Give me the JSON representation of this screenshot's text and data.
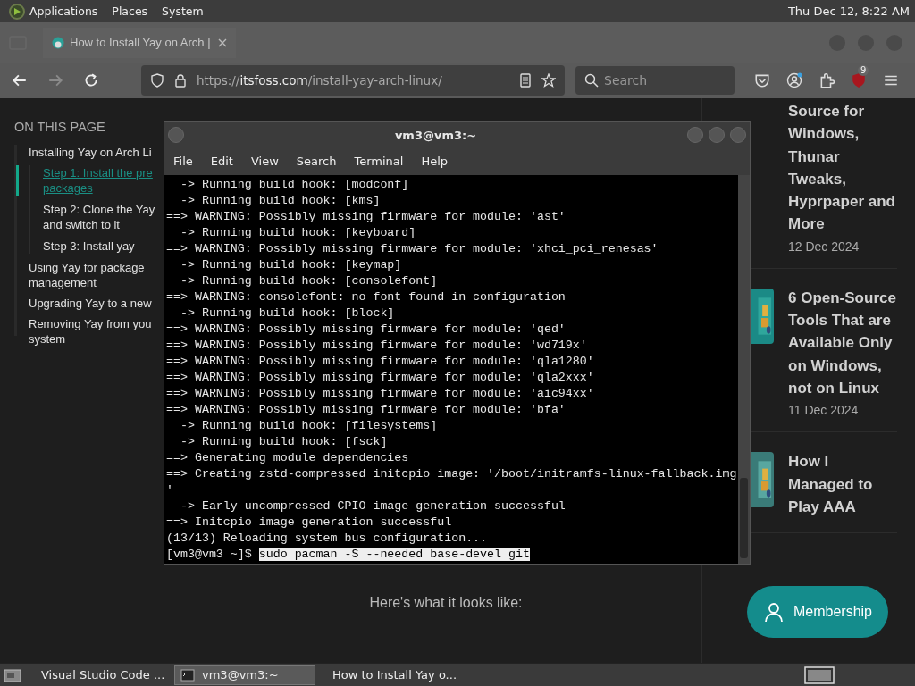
{
  "top_panel": {
    "menus": [
      "Applications",
      "Places",
      "System"
    ],
    "clock": "Thu Dec 12,  8:22 AM"
  },
  "browser": {
    "tabs": [
      {
        "title": "How to Install Yay on Arch |",
        "selected": true
      }
    ],
    "nav_buttons": [
      {
        "kind": "back",
        "disabled": false
      },
      {
        "kind": "forward",
        "disabled": true
      },
      {
        "kind": "reload",
        "disabled": false
      }
    ],
    "url": {
      "scheme": "https://",
      "host": "itsfoss.com",
      "path": "/install-yay-arch-linux/"
    },
    "search": {
      "placeholder": "Search"
    },
    "extension_badge": "9"
  },
  "toc": {
    "heading": "ON THIS PAGE",
    "items": [
      {
        "label": "Installing Yay on Arch Li",
        "selected": false,
        "children": [
          {
            "label": "Step 1: Install the pre packages",
            "selected": true
          },
          {
            "label": "Step 2: Clone the Yay and switch to it",
            "selected": false
          },
          {
            "label": "Step 3: Install yay",
            "selected": false
          }
        ]
      },
      {
        "label": "Using Yay for package management",
        "selected": false
      },
      {
        "label": "Upgrading Yay to a new",
        "selected": false
      },
      {
        "label": "Removing Yay from you system",
        "selected": false
      }
    ]
  },
  "article": {
    "caption": "Here's what it looks like:"
  },
  "sidebar_posts": [
    {
      "title": "Source for Windows, Thunar Tweaks, Hyprpaper and More",
      "date": "12 Dec 2024",
      "thumbnail": false
    },
    {
      "title": "6 Open-Source Tools That are Available Only on Windows, not on Linux",
      "date": "11 Dec 2024",
      "thumbnail": true
    },
    {
      "title": "How I Managed to Play AAA",
      "thumbnail": true
    }
  ],
  "membership_button": {
    "label": "Membership"
  },
  "terminal": {
    "title": "vm3@vm3:~",
    "menus": [
      "File",
      "Edit",
      "View",
      "Search",
      "Terminal",
      "Help"
    ],
    "lines": [
      "  -> Running build hook: [modconf]",
      "  -> Running build hook: [kms]",
      "==> WARNING: Possibly missing firmware for module: 'ast'",
      "  -> Running build hook: [keyboard]",
      "==> WARNING: Possibly missing firmware for module: 'xhci_pci_renesas'",
      "  -> Running build hook: [keymap]",
      "  -> Running build hook: [consolefont]",
      "==> WARNING: consolefont: no font found in configuration",
      "  -> Running build hook: [block]",
      "==> WARNING: Possibly missing firmware for module: 'qed'",
      "==> WARNING: Possibly missing firmware for module: 'wd719x'",
      "==> WARNING: Possibly missing firmware for module: 'qla1280'",
      "==> WARNING: Possibly missing firmware for module: 'qla2xxx'",
      "==> WARNING: Possibly missing firmware for module: 'aic94xx'",
      "==> WARNING: Possibly missing firmware for module: 'bfa'",
      "  -> Running build hook: [filesystems]",
      "  -> Running build hook: [fsck]",
      "==> Generating module dependencies",
      "==> Creating zstd-compressed initcpio image: '/boot/initramfs-linux-fallback.img",
      "'",
      "  -> Early uncompressed CPIO image generation successful",
      "==> Initcpio image generation successful",
      "(13/13) Reloading system bus configuration..."
    ],
    "prompt": "[vm3@vm3 ~]$ ",
    "command": "sudo pacman -S --needed base-devel git"
  },
  "taskbar": {
    "items": [
      {
        "label": "Visual Studio Code ...",
        "kind": "vscode",
        "selected": false
      },
      {
        "label": "vm3@vm3:~",
        "kind": "terminal",
        "selected": true
      },
      {
        "label": "How to Install Yay o...",
        "kind": "firefox",
        "selected": false
      }
    ]
  }
}
